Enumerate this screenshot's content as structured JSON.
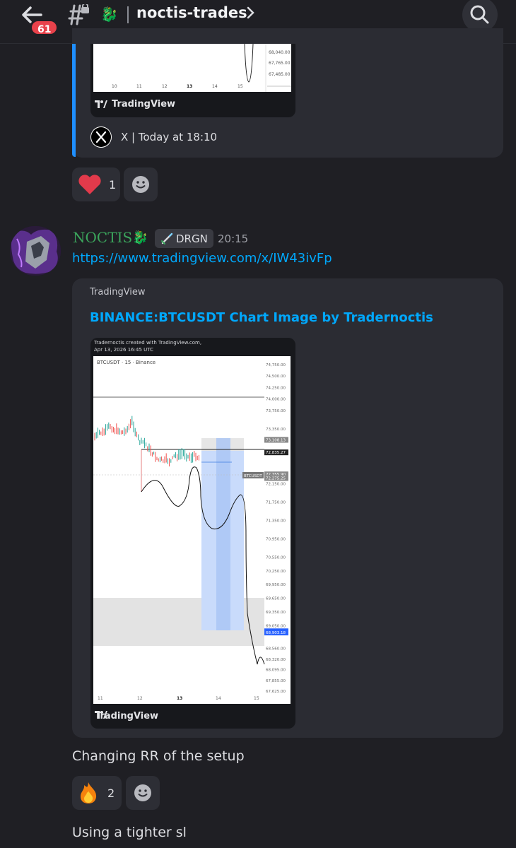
{
  "header": {
    "badge_count": "61",
    "channel_name": "noctis-trades",
    "channel_emoji": "🐉"
  },
  "embed_top": {
    "y_ticks": [
      "68,040.00",
      "67,765.00",
      "67,485.00"
    ],
    "x_ticks": [
      "10",
      "11",
      "12",
      "13",
      "14",
      "15"
    ],
    "brand": "TradingView",
    "source": "X | Today at 18:10"
  },
  "reactions_1": [
    {
      "icon": "heart-icon",
      "count": "1"
    }
  ],
  "message": {
    "author": "NOCTIS",
    "author_emoji": "🐉",
    "role_tag": "DRGN",
    "role_icon": "sword-icon",
    "time": "20:15",
    "link": "https://www.tradingview.com/x/IW43ivFp",
    "embed": {
      "provider": "TradingView",
      "title": "BINANCE:BTCUSDT Chart Image by Tradernoctis",
      "caption_line1": "Tradernoctis created with TradingView.com,",
      "caption_line2": "Apr 13, 2026 16:45 UTC",
      "symbol_label": "BTCUSDT · 15 · Binance",
      "brand": "TradingView"
    }
  },
  "chart_data": {
    "type": "line",
    "title": "BTCUSDT · 15 · Binance",
    "x_ticks": [
      "11",
      "12",
      "13",
      "14",
      "15"
    ],
    "y_ticks": [
      "74,750.00",
      "74,500.00",
      "74,250.00",
      "74,000.00",
      "73,750.00",
      "73,350.00",
      "72,150.00",
      "71,750.00",
      "71,350.00",
      "70,950.00",
      "70,550.00",
      "70,250.00",
      "69,950.00",
      "69,650.00",
      "69,350.00",
      "69,050.00",
      "68,560.00",
      "68,320.00",
      "68,095.00",
      "67,855.00",
      "67,625.00"
    ],
    "price_labels": [
      "73,109.90",
      "73,108.13",
      "72,837.04",
      "72,835.27",
      "72,355.90",
      "72,275.25",
      "68,931.65",
      "68,903.18"
    ],
    "series_label": "BTCUSDT",
    "ylim": [
      67625,
      74750
    ],
    "grid": false
  },
  "message_texts": [
    "Changing RR of the setup",
    "Using a tighter sl"
  ],
  "reactions_2": [
    {
      "icon": "fire-icon",
      "count": "2"
    }
  ]
}
